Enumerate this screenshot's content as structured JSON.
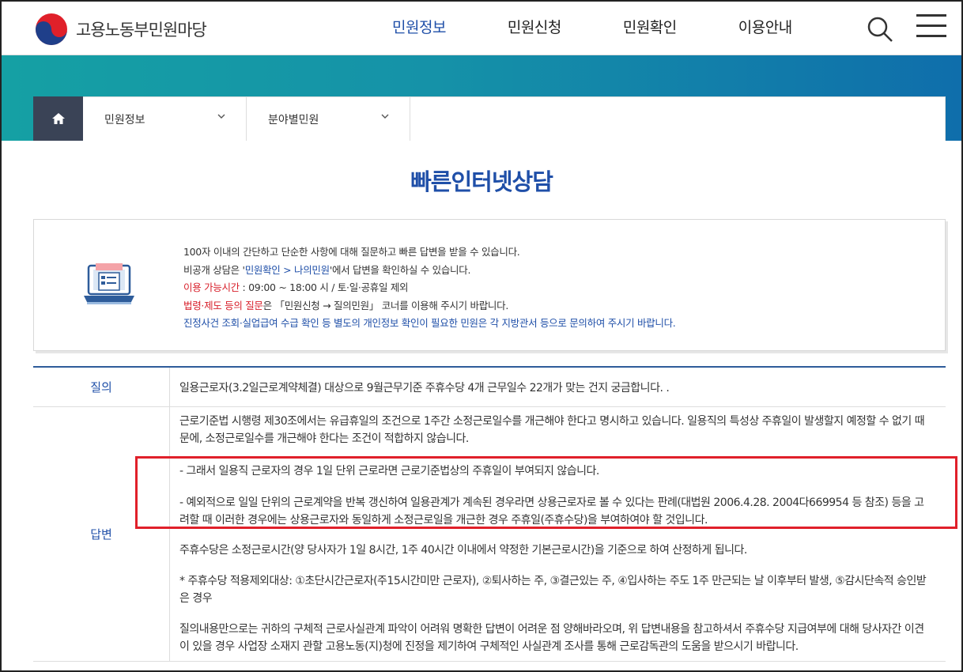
{
  "header": {
    "logo_text": "고용노동부민원마당",
    "nav": [
      {
        "label": "민원정보"
      },
      {
        "label": "민원신청"
      },
      {
        "label": "민원확인"
      },
      {
        "label": "이용안내"
      }
    ],
    "search_icon": "search-icon",
    "menu_icon": "hamburger-menu-icon"
  },
  "breadcrumb": {
    "home_icon": "home-icon",
    "items": [
      {
        "label": "민원정보"
      },
      {
        "label": "분야별민원"
      }
    ]
  },
  "page": {
    "title": "빠른인터넷상담"
  },
  "info": {
    "line1": "100자 이내의 간단하고 단순한 사항에 대해 질문하고 빠른 답변을 받을 수 있습니다.",
    "line2_pre": "비공개 상담은 '",
    "line2_link": "민원확인 > 나의민원",
    "line2_post": "'에서 답변을 확인하실 수 있습니다.",
    "line3_label": "이용 가능시간",
    "line3_value": " : 09:00 ~ 18:00 시 / 토·일·공휴일 제외",
    "line4_label": "법령·제도 등의 질문",
    "line4_value": "은 「민원신청 → 질의민원」 코너를 이용해 주시기 바랍니다.",
    "line5": "진정사건 조회·실업급여 수급 확인 등 별도의 개인정보 확인이 필요한 민원은 각 지방관서 등으로 문의하여 주시기 바랍니다."
  },
  "qa": {
    "question_label": "질의",
    "question_text": "일용근로자(3.2일근로계약체결) 대상으로 9월근무기준 주휴수당 4개 근무일수 22개가 맞는 건지 궁금합니다. .",
    "answer_label": "답변",
    "answer_paragraphs": [
      "근로기준법 시행령 제30조에서는 유급휴일의 조건으로 1주간 소정근로일수를 개근해야 한다고 명시하고 있습니다. 일용직의 특성상 주휴일이 발생할지 예정할 수 없기 때문에, 소정근로일수를 개근해야 한다는 조건이 적합하지 않습니다.",
      "- 그래서 일용직 근로자의 경우 1일 단위 근로라면 근로기준법상의 주휴일이 부여되지 않습니다.",
      "- 예외적으로 일일 단위의 근로계약을 반복 갱신하여 일용관계가 계속된 경우라면 상용근로자로 볼 수 있다는 판례(대법원 2006.4.28. 2004다669954 등 참조) 등을 고려할 때 이러한 경우에는 상용근로자와 동일하게 소정근로일을 개근한 경우 주휴일(주휴수당)을 부여하여야 할 것입니다.",
      "주휴수당은 소정근로시간(양 당사자가 1일 8시간, 1주 40시간 이내에서 약정한 기본근로시간)을 기준으로 하여 산정하게 됩니다.",
      "* 주휴수당 적용제외대상: ①초단시간근로자(주15시간미만 근로자), ②퇴사하는 주, ③결근있는 주, ④입사하는 주도 1주 만근되는 날 이후부터 발생, ⑤감시단속적 승인받은 경우",
      "질의내용만으로는 귀하의 구체적 근로사실관계 파악이 어려워 명확한 답변이 어려운 점 양해바라오며, 위 답변내용을 참고하셔서 주휴수당 지급여부에 대해 당사자간 이견이 있을 경우 사업장 소재지 관할 고용노동(지)청에 진정을 제기하여 구체적인 사실관계 조사를 통해 근로감독관의 도움을 받으시기 바랍니다."
    ]
  },
  "colors": {
    "accent_blue": "#1f4fa8",
    "highlight_red": "#e0202a",
    "banner_teal": "#15a0a4",
    "banner_blue": "#0f6eab"
  }
}
